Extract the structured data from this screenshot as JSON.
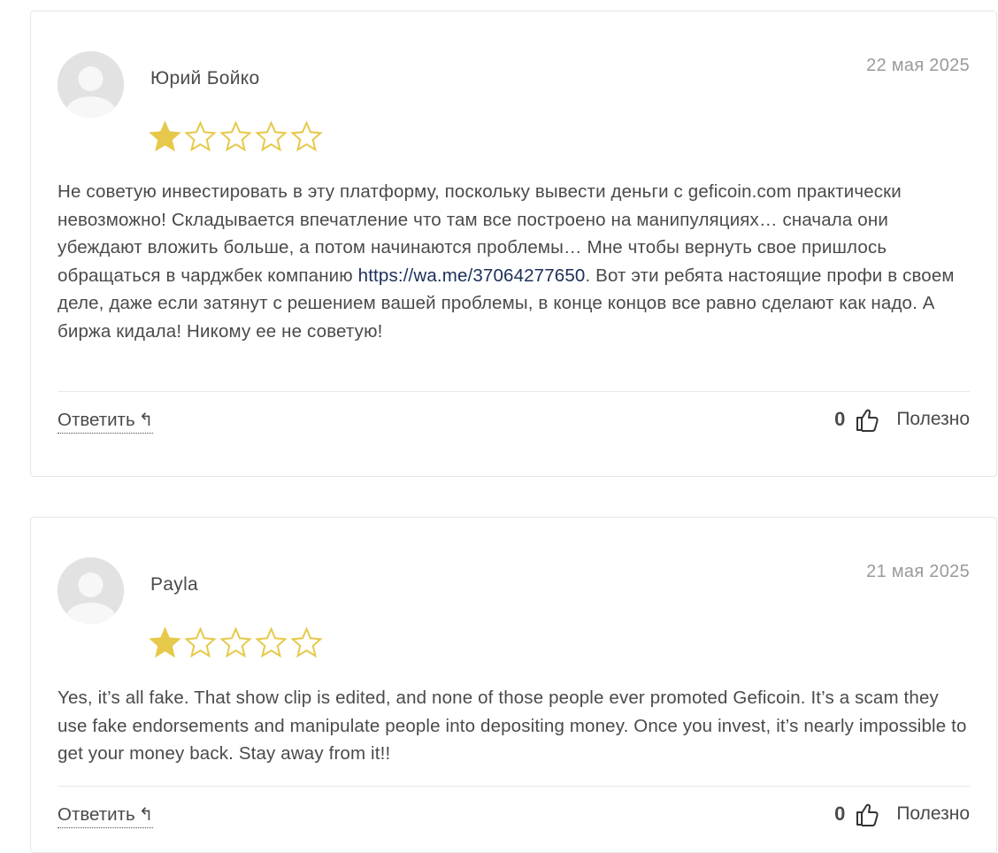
{
  "reviews": [
    {
      "author": "Юрий Бойко",
      "date": "22 мая 2025",
      "rating": 1,
      "max_rating": 5,
      "text_before_link": "Не советую инвестировать в эту платформу, поскольку вывести деньги с geficoin.com практически невозможно! Складывается впечатление что там все построено на манипуляциях… сначала они убеждают вложить больше, а потом начинаются проблемы… Мне чтобы вернуть свое пришлось обращаться в чарджбек компанию ",
      "link": "https://wa.me/37064277650",
      "text_after_link": ". Вот эти ребята настоящие профи в своем деле, даже если затянут с решением вашей проблемы, в конце концов все равно сделают как надо. А биржа кидала! Никому ее не советую!",
      "reply_label": "Ответить",
      "reply_icon": "↰",
      "likes": "0",
      "helpful_label": "Полезно"
    },
    {
      "author": "Payla",
      "date": "21 мая 2025",
      "rating": 1,
      "max_rating": 5,
      "text": "Yes, it’s all fake. That show clip is edited, and none of those people ever promoted Geficoin. It’s a scam they use fake endorsements and manipulate people into depositing money. Once you invest, it’s nearly impossible to get your money back. Stay away from it!!",
      "reply_label": "Ответить",
      "reply_icon": "↰",
      "likes": "0",
      "helpful_label": "Полезно"
    }
  ],
  "colors": {
    "star_fill": "#e6c94a",
    "star_outline": "#e6c94a",
    "link": "#1b2f57",
    "date": "#9a9a9a",
    "border": "#e6e6e6"
  },
  "icons": {
    "avatar": "user-placeholder-icon",
    "star_filled": "star-filled-icon",
    "star_empty": "star-outline-icon",
    "thumb": "thumbs-up-icon",
    "reply": "reply-arrow-icon"
  }
}
